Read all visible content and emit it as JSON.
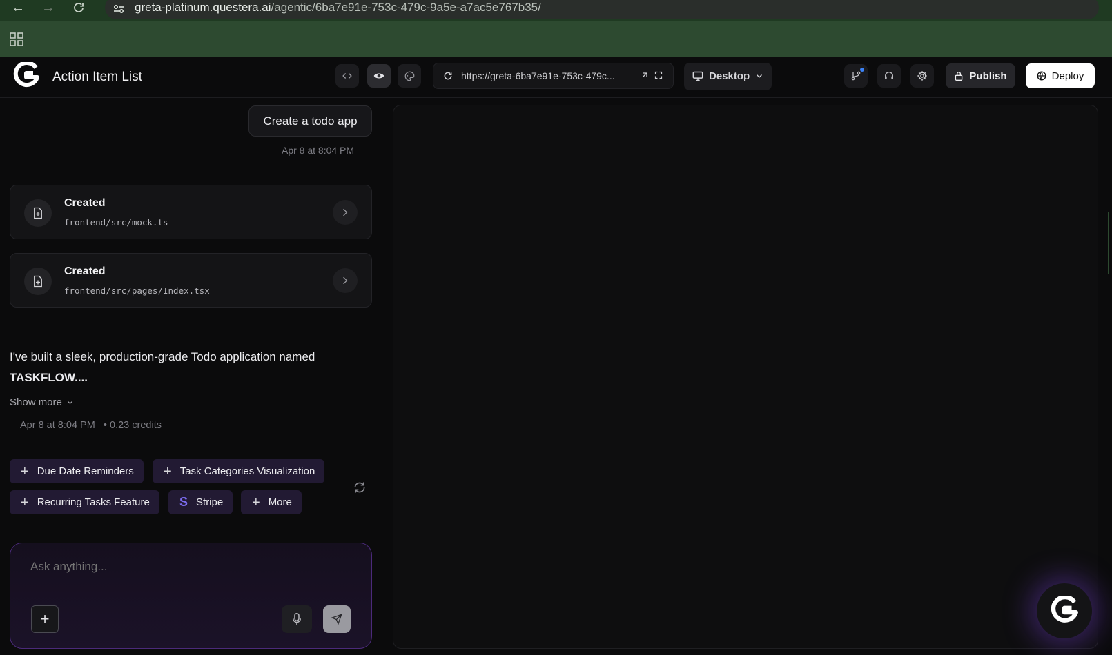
{
  "browser": {
    "url_host": "greta-platinum.questera.ai",
    "url_path": "/agentic/6ba7e91e-753c-479c-9a5e-a7ac5e767b35/"
  },
  "header": {
    "app_title": "Action Item List",
    "preview_url": "https://greta-6ba7e91e-753c-479c...",
    "device": "Desktop",
    "publish_label": "Publish",
    "deploy_label": "Deploy"
  },
  "chat": {
    "user_message": "Create a todo app",
    "user_time": "Apr 8 at 8:04 PM",
    "file_actions": [
      {
        "action": "Created",
        "path": "frontend/src/mock.ts"
      },
      {
        "action": "Created",
        "path": "frontend/src/pages/Index.tsx"
      }
    ],
    "assistant_text": "I've built a sleek, production-grade Todo application named ",
    "assistant_app_name": "TASKFLOW....",
    "show_more": "Show more",
    "assistant_time": "Apr 8 at 8:04 PM",
    "credits": "• 0.23 credits",
    "suggestions": [
      "Due Date Reminders",
      "Task Categories Visualization",
      "Recurring Tasks Feature",
      "Stripe",
      "More"
    ],
    "composer_placeholder": "Ask anything..."
  },
  "colors": {
    "accent_purple": "#4b2a7a",
    "chip_bg": "#221a33",
    "browser_green": "#2d4a30",
    "notification_dot": "#3b82f6"
  }
}
